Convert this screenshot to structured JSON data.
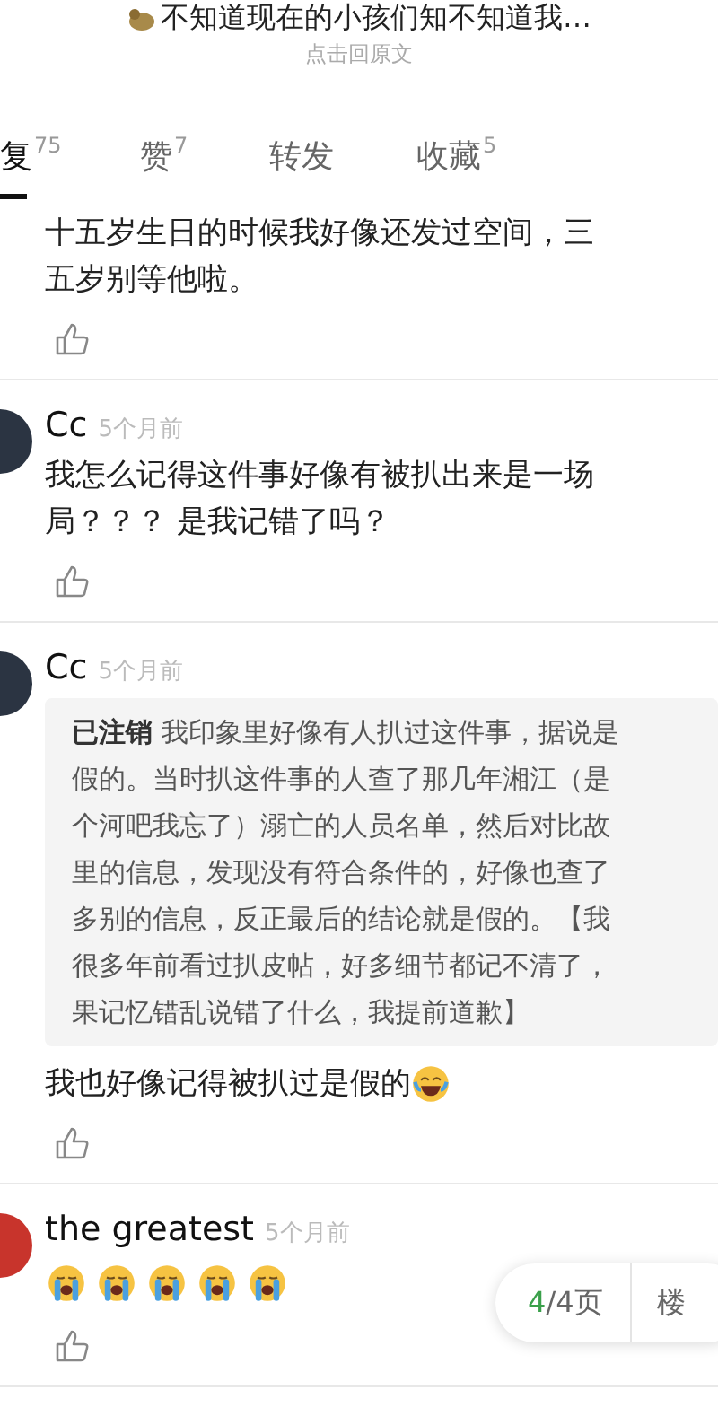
{
  "header": {
    "title": "不知道现在的小孩们知不知道我…",
    "subtitle": "点击回原文"
  },
  "tabs": [
    {
      "label": "复",
      "count": "75",
      "selected": true
    },
    {
      "label": "赞",
      "count": "7",
      "selected": false
    },
    {
      "label": "转发",
      "selected": false
    },
    {
      "label": "收藏",
      "count": "5",
      "selected": false
    }
  ],
  "comments": [
    {
      "lines": [
        "十五岁生日的时候我好像还发过空间，三",
        "五岁别等他啦。"
      ]
    },
    {
      "author": "Cc",
      "time": "5个月前",
      "avatar": {
        "color": "#2b3442"
      },
      "lines": [
        "我怎么记得这件事好像有被扒出来是一场",
        "局？？？ 是我记错了吗？"
      ]
    },
    {
      "author": "Cc",
      "time": "5个月前",
      "avatar": {
        "color": "#2b3442"
      },
      "quote": [
        "**已注销** 我印象里好像有人扒过这件事，据说是",
        "假的。当时扒这件事的人查了那几年湘江（是",
        "个河吧我忘了）溺亡的人员名单，然后对比故",
        "里的信息，发现没有符合条件的，好像也查了",
        "多别的信息，反正最后的结论就是假的。【我",
        "很多年前看过扒皮帖，好多细节都记不清了，",
        "果记忆错乱说错了什么，我提前道歉】"
      ],
      "lines": [
        "我也好像记得被扒过是假的"
      ],
      "emojis": [
        {
          "kind": "laugh"
        }
      ]
    },
    {
      "author": "the greatest",
      "time": "5个月前",
      "avatar": {
        "color": "#c8342c"
      },
      "emojis": [
        {
          "kind": "cry"
        },
        {
          "kind": "cry"
        },
        {
          "kind": "cry"
        },
        {
          "kind": "cry"
        },
        {
          "kind": "cry"
        }
      ]
    }
  ],
  "pager": {
    "current": "4",
    "total": "/4页",
    "owner": "楼"
  }
}
